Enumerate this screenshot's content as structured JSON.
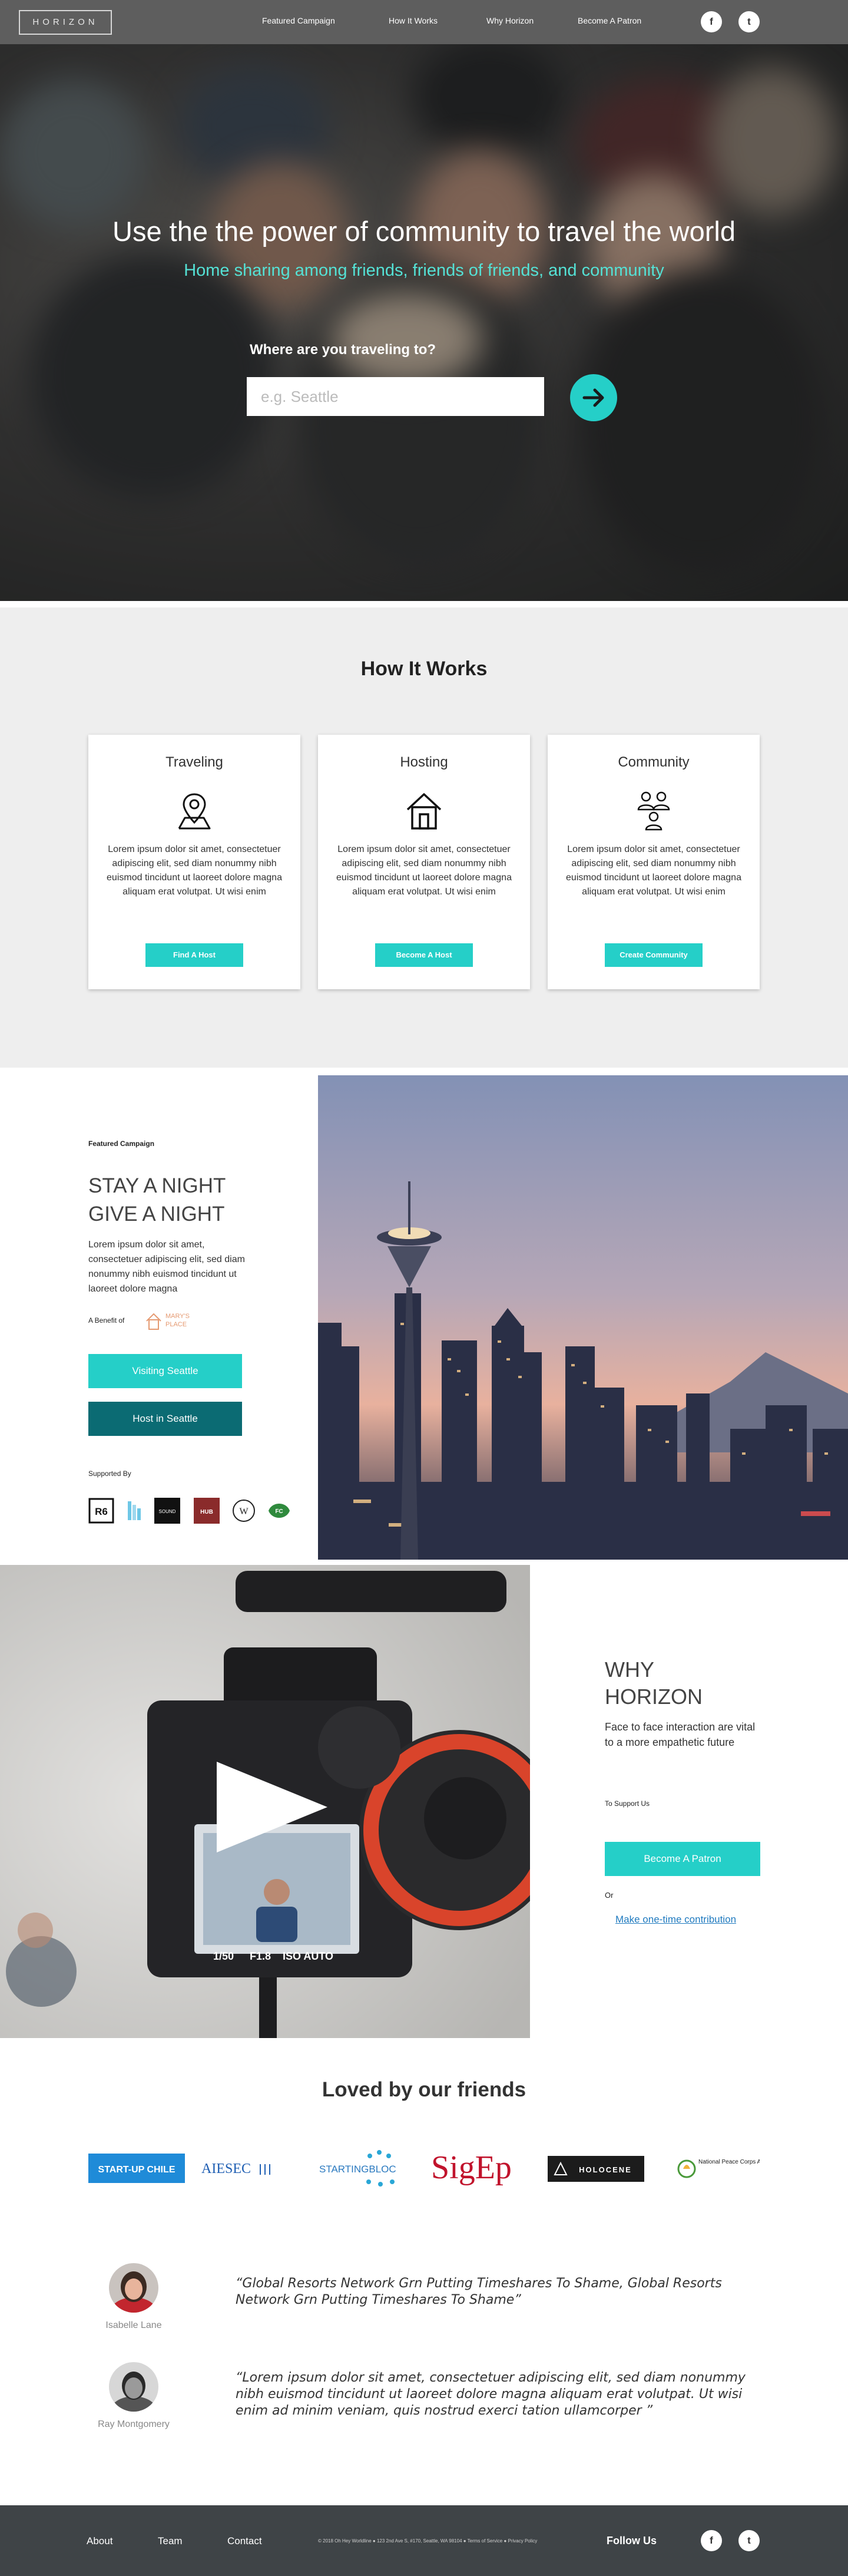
{
  "nav": {
    "logo": "HORIZON",
    "links": [
      "Featured Campaign",
      "How It Works",
      "Why Horizon",
      "Become A Patron"
    ],
    "social": [
      {
        "icon": "facebook-icon",
        "glyph": "f"
      },
      {
        "icon": "twitter-icon",
        "glyph": "t"
      }
    ]
  },
  "hero": {
    "title": "Use the the power of community to travel the world",
    "subtitle": "Home sharing among friends, friends of friends, and community",
    "question": "Where are you traveling to?",
    "placeholder": "e.g. Seattle"
  },
  "how": {
    "title": "How It Works",
    "cards": [
      {
        "title": "Traveling",
        "icon": "map-pin-icon",
        "text": "Lorem ipsum dolor sit amet, consectetuer adipiscing elit, sed diam nonummy nibh euismod tincidunt ut laoreet dolore magna aliquam erat volutpat. Ut wisi enim",
        "button": "Find A Host"
      },
      {
        "title": "Hosting",
        "icon": "house-icon",
        "text": "Lorem ipsum dolor sit amet, consectetuer adipiscing elit, sed diam nonummy nibh euismod tincidunt ut laoreet dolore magna aliquam erat volutpat. Ut wisi enim",
        "button": "Become A Host"
      },
      {
        "title": "Community",
        "icon": "people-icon",
        "text": "Lorem ipsum dolor sit amet, consectetuer adipiscing elit, sed diam nonummy nibh euismod tincidunt ut laoreet dolore magna aliquam erat volutpat. Ut wisi enim",
        "button": "Create  Community"
      }
    ]
  },
  "featured": {
    "label": "Featured Campaign",
    "title_line1": "STAY A NIGHT",
    "title_line2": "GIVE A NIGHT",
    "body": "Lorem ipsum dolor sit amet, consectetuer adipiscing elit, sed diam nonummy nibh euismod tincidunt ut laoreet dolore magna",
    "benefit_label": "A Benefit of",
    "benefit_logo_text": [
      "MARY'S",
      "PLACE"
    ],
    "visit_button": "Visiting Seattle",
    "host_button": "Host in Seattle",
    "supported_by": "Supported By",
    "sponsors": [
      "R6",
      "RB",
      "SOUND",
      "HUB",
      "W",
      "FC"
    ]
  },
  "why": {
    "title_line1": "WHY",
    "title_line2": "HORIZON",
    "text": "Face to face interaction are vital to a more empathetic future",
    "support_label": "To Support Us",
    "patron_button": "Become A Patron",
    "or": "Or",
    "link": "Make one-time contribution",
    "camera_labels": [
      "1/50",
      "F1.8",
      "ISO AUTO"
    ]
  },
  "loved": {
    "title": "Loved by our friends",
    "partners": [
      "START-UP CHILE",
      "AIESEC",
      "STARTINGBLOC",
      "SigEp",
      "HOLOCENE",
      "National Peace Corps Association"
    ],
    "testimonials": [
      {
        "name": "Isabelle Lane",
        "quote": "“Global Resorts Network Grn Putting Timeshares To Shame, Global Resorts Network Grn Putting Timeshares To Shame”"
      },
      {
        "name": "Ray Montgomery",
        "quote": "“Lorem ipsum dolor sit amet, consectetuer adipiscing elit, sed diam nonummy nibh euismod tincidunt ut laoreet dolore magna aliquam erat volutpat. Ut wisi enim ad minim veniam, quis nostrud exerci tation ullamcorper ”"
      }
    ]
  },
  "footer": {
    "links": [
      "About",
      "Team",
      "Contact"
    ],
    "copyright": "© 2018 Oh Hey Worldline ● 123 2nd Ave S, #170, Seattle, WA 98104 ● Terms of Service ● Privacy Policy",
    "follow": "Follow Us"
  },
  "colors": {
    "accent": "#25cfc8",
    "dark_teal": "#0b6b73",
    "nav_bg": "#5e5e5e",
    "footer_bg": "#3f4447",
    "section_gray": "#eeeeee"
  }
}
